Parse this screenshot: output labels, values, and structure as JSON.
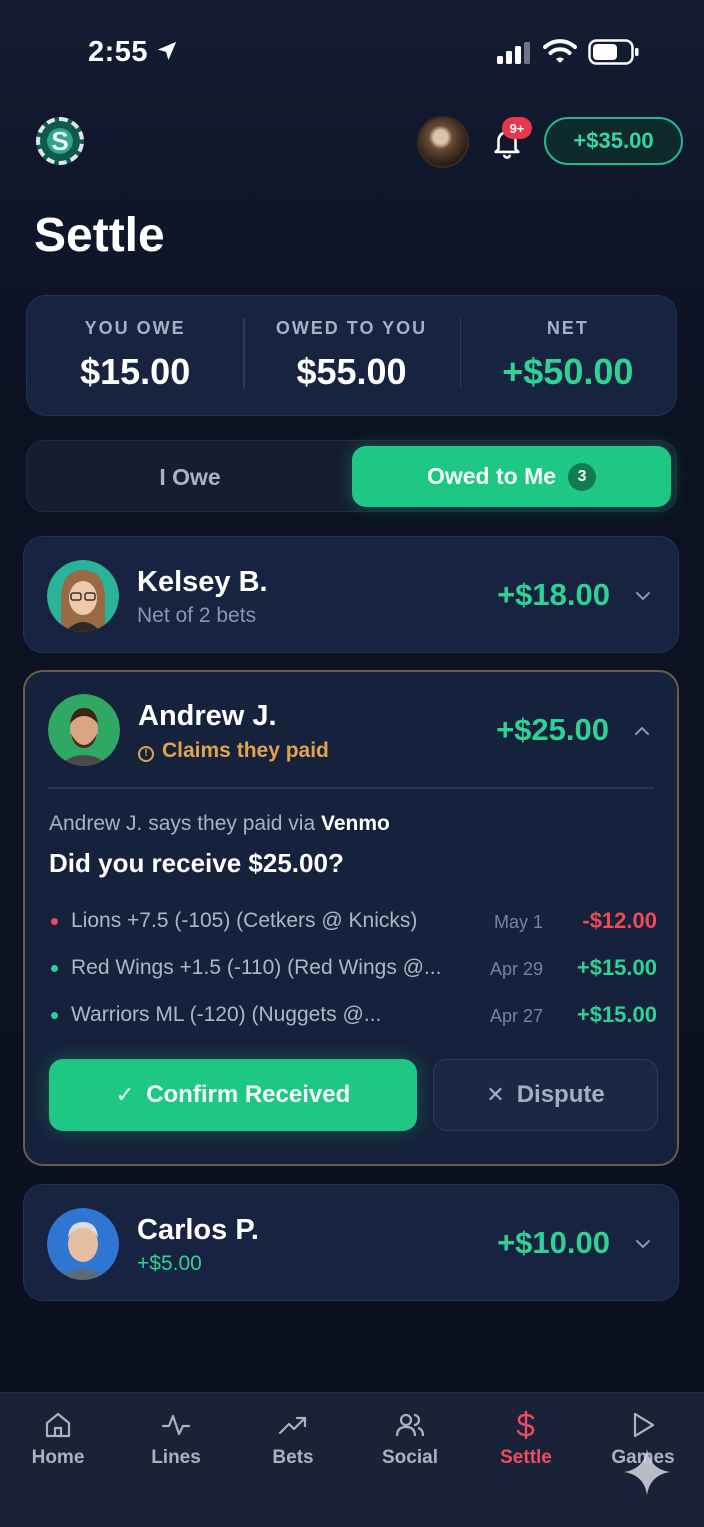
{
  "status_bar": {
    "time": "2:55"
  },
  "header": {
    "notification_badge": "9+",
    "balance": "+$35.00",
    "logo_letter": "S"
  },
  "page": {
    "title": "Settle"
  },
  "summary": {
    "you_owe_label": "YOU OWE",
    "you_owe_value": "$15.00",
    "owed_to_you_label": "OWED TO YOU",
    "owed_to_you_value": "$55.00",
    "net_label": "NET",
    "net_value": "+$50.00"
  },
  "segment": {
    "i_owe": "I Owe",
    "owed_to_me": "Owed to Me",
    "owed_to_me_count": "3"
  },
  "people": [
    {
      "name": "Kelsey B.",
      "subtitle": "Net of 2 bets",
      "amount": "+$18.00"
    },
    {
      "name": "Andrew J.",
      "status": "Claims they paid",
      "amount": "+$25.00",
      "paid_prefix": "Andrew J. says they paid via",
      "paid_method": "Venmo",
      "question": "Did you receive $25.00?",
      "bets": [
        {
          "desc": "Lions +7.5 (-105) (Cetkers @ Knicks)",
          "date": "May 1",
          "amount": "-$12.00",
          "result": "loss"
        },
        {
          "desc": "Red Wings +1.5 (-110) (Red Wings @...",
          "date": "Apr 29",
          "amount": "+$15.00",
          "result": "win"
        },
        {
          "desc": "Warriors ML (-120) (Nuggets @...",
          "date": "Apr 27",
          "amount": "+$15.00",
          "result": "win"
        }
      ],
      "confirm_label": "Confirm Received",
      "dispute_label": "Dispute"
    },
    {
      "name": "Carlos P.",
      "subtitle": "+$5.00",
      "amount": "+$10.00"
    }
  ],
  "tabs": [
    {
      "label": "Home",
      "icon": "home-icon"
    },
    {
      "label": "Lines",
      "icon": "activity-icon"
    },
    {
      "label": "Bets",
      "icon": "trending-up-icon"
    },
    {
      "label": "Social",
      "icon": "users-icon"
    },
    {
      "label": "Settle",
      "icon": "dollar-icon",
      "active": true
    },
    {
      "label": "Games",
      "icon": "play-icon"
    }
  ],
  "colors": {
    "accent_green": "#1fc784",
    "positive": "#2ed394",
    "negative": "#ef4a57",
    "warning": "#e2a34a",
    "active_tab": "#f04b60"
  }
}
